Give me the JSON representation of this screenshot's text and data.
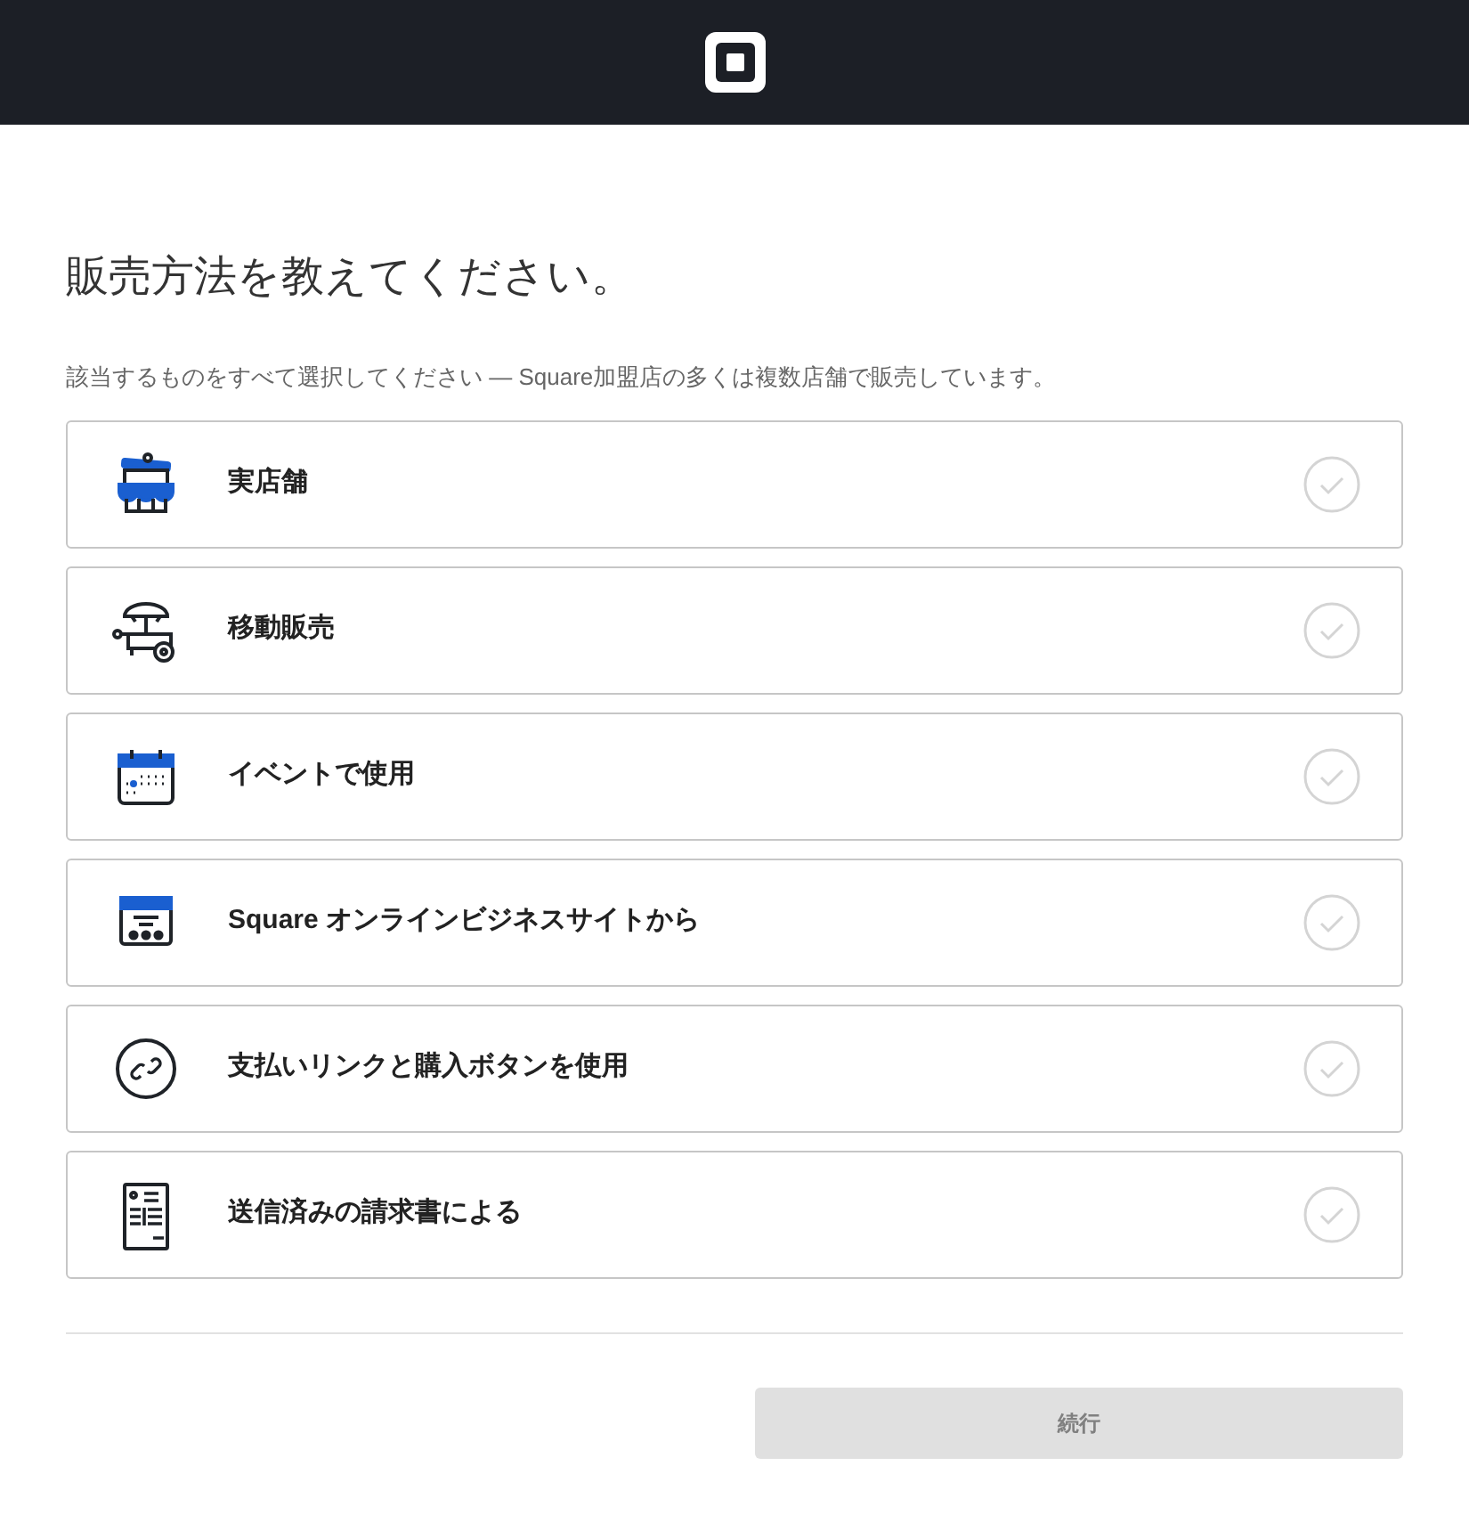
{
  "title": "販売方法を教えてください。",
  "subtitle": "該当するものをすべて選択してください — Square加盟店の多くは複数店舗で販売しています。",
  "options": [
    {
      "kind": "store",
      "label": "実店舗",
      "selected": false
    },
    {
      "kind": "cart",
      "label": "移動販売",
      "selected": false
    },
    {
      "kind": "calendar",
      "label": "イベントで使用",
      "selected": false
    },
    {
      "kind": "website",
      "label": "Square オンラインビジネスサイトから",
      "selected": false
    },
    {
      "kind": "link",
      "label": "支払いリンクと購入ボタンを使用",
      "selected": false
    },
    {
      "kind": "invoice",
      "label": "送信済みの請求書による",
      "selected": false
    }
  ],
  "continue_button": {
    "label": "続行",
    "disabled": true
  }
}
